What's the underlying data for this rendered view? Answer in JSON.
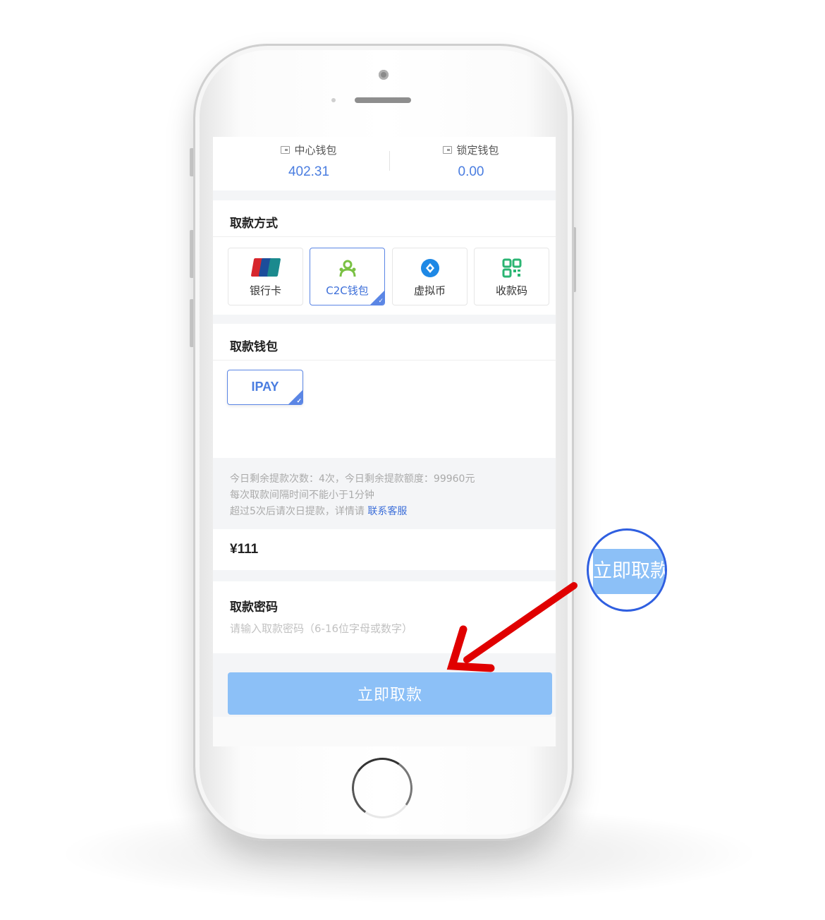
{
  "wallets": {
    "center": {
      "label": "中心钱包",
      "value": "402.31"
    },
    "locked": {
      "label": "锁定钱包",
      "value": "0.00"
    }
  },
  "withdraw_method": {
    "title": "取款方式",
    "options": [
      {
        "label": "银行卡",
        "icon": "unionpay-card-icon",
        "selected": false
      },
      {
        "label": "C2C钱包",
        "icon": "c2c-users-icon",
        "selected": true
      },
      {
        "label": "虚拟币",
        "icon": "crypto-coin-icon",
        "selected": false
      },
      {
        "label": "收款码",
        "icon": "qr-code-icon",
        "selected": false
      }
    ]
  },
  "withdraw_wallet": {
    "title": "取款钱包",
    "options": [
      {
        "label": "IPAY",
        "selected": true
      }
    ]
  },
  "info": {
    "line1": "今日剩余提款次数：4次，今日剩余提款额度：99960元",
    "line2": "每次取款间隔时间不能小于1分钟",
    "line3": "超过5次后请次日提款，详情请",
    "link": "联系客服"
  },
  "amount": {
    "value": "¥111"
  },
  "password": {
    "label": "取款密码",
    "placeholder": "请输入取款密码（6-16位字母或数字）"
  },
  "submit": {
    "label": "立即取款"
  },
  "zoom_callout": {
    "label": "立即取款"
  },
  "colors": {
    "accent": "#4a7de0",
    "button": "#8cc0f7",
    "arrow": "#e00000",
    "callout_ring": "#2f5fe0"
  }
}
